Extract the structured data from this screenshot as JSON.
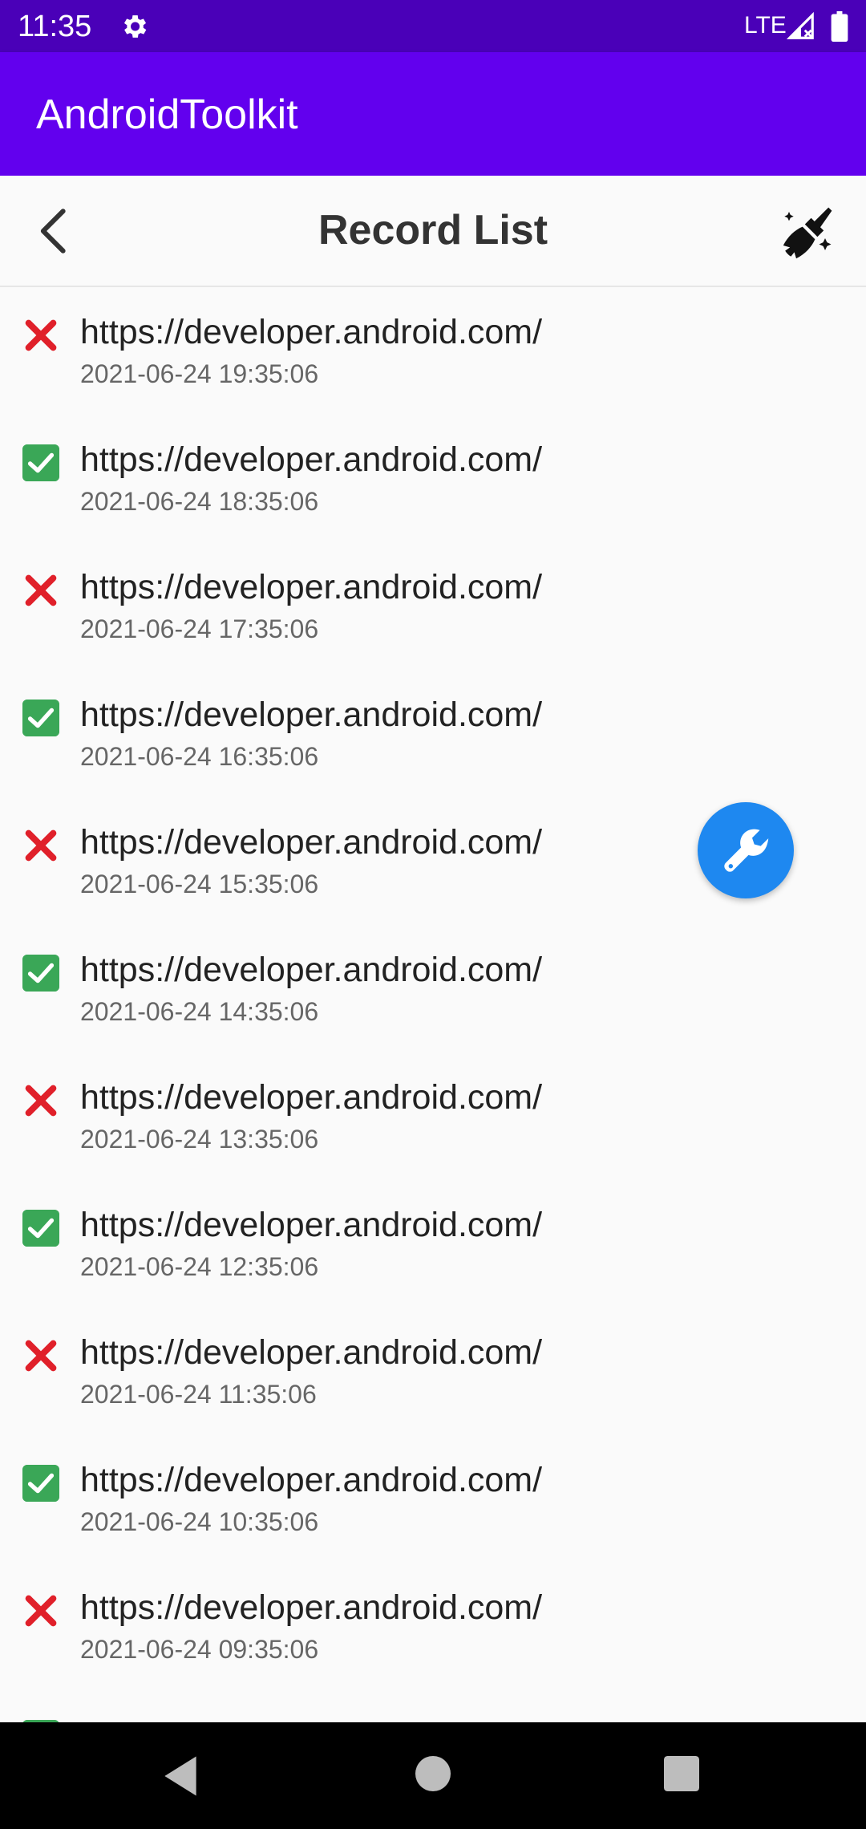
{
  "status_bar": {
    "time": "11:35",
    "network": "LTE",
    "icons": [
      "gear-icon",
      "signal-icon",
      "battery-icon"
    ]
  },
  "app_bar": {
    "title": "AndroidToolkit"
  },
  "toolbar": {
    "title": "Record List",
    "back_icon": "chevron-left-icon",
    "clear_icon": "broom-icon"
  },
  "records": [
    {
      "status": "fail",
      "url": "https://developer.android.com/",
      "time": "2021-06-24 19:35:06"
    },
    {
      "status": "success",
      "url": "https://developer.android.com/",
      "time": "2021-06-24 18:35:06"
    },
    {
      "status": "fail",
      "url": "https://developer.android.com/",
      "time": "2021-06-24 17:35:06"
    },
    {
      "status": "success",
      "url": "https://developer.android.com/",
      "time": "2021-06-24 16:35:06"
    },
    {
      "status": "fail",
      "url": "https://developer.android.com/",
      "time": "2021-06-24 15:35:06"
    },
    {
      "status": "success",
      "url": "https://developer.android.com/",
      "time": "2021-06-24 14:35:06"
    },
    {
      "status": "fail",
      "url": "https://developer.android.com/",
      "time": "2021-06-24 13:35:06"
    },
    {
      "status": "success",
      "url": "https://developer.android.com/",
      "time": "2021-06-24 12:35:06"
    },
    {
      "status": "fail",
      "url": "https://developer.android.com/",
      "time": "2021-06-24 11:35:06"
    },
    {
      "status": "success",
      "url": "https://developer.android.com/",
      "time": "2021-06-24 10:35:06"
    },
    {
      "status": "fail",
      "url": "https://developer.android.com/",
      "time": "2021-06-24 09:35:06"
    },
    {
      "status": "success",
      "url": "",
      "time": ""
    }
  ],
  "fab": {
    "icon": "wrench-icon"
  },
  "colors": {
    "status_bar": "#4a00b8",
    "app_bar": "#6200ee",
    "fab": "#1e88f0",
    "success": "#3aa757",
    "fail": "#e0202a"
  },
  "nav_bar": {
    "icons": [
      "nav-back-icon",
      "nav-home-icon",
      "nav-recents-icon"
    ]
  }
}
